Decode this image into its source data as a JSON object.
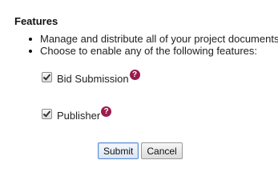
{
  "section": {
    "title": "Features"
  },
  "bullets": [
    "Manage and distribute all of your project documents",
    "Choose to enable any of the following features:"
  ],
  "features": [
    {
      "label": "Bid Submission",
      "checked": true,
      "help_icon": "help-icon",
      "help_glyph": "?"
    },
    {
      "label": "Publisher",
      "checked": true,
      "help_icon": "help-icon",
      "help_glyph": "?"
    }
  ],
  "actions": {
    "submit_label": "Submit",
    "cancel_label": "Cancel"
  },
  "colors": {
    "help_badge": "#9b1b4d",
    "focus_border": "#5b8fd6"
  }
}
